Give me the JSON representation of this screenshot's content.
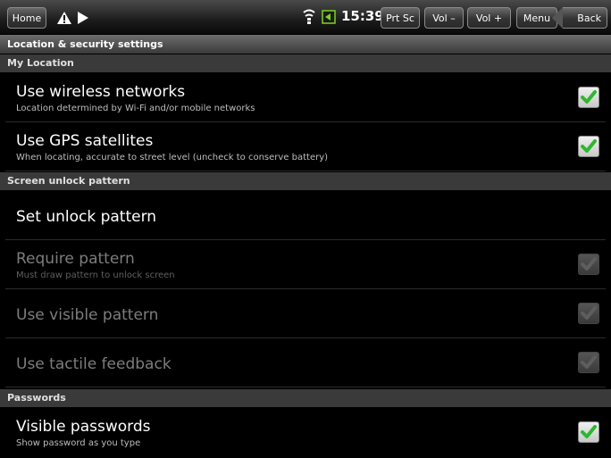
{
  "statusbar": {
    "home_label": "Home",
    "time": "15:39",
    "buttons": [
      "Prt Sc",
      "Vol –",
      "Vol +",
      "Menu"
    ],
    "back_label": "Back",
    "icons": [
      "warning-icon",
      "play-icon",
      "wifi-signal-icon",
      "battery-icon"
    ]
  },
  "page": {
    "title": "Location & security settings"
  },
  "sections": {
    "location": "My Location",
    "unlock": "Screen unlock pattern",
    "passwords": "Passwords"
  },
  "items": [
    {
      "title": "Use wireless networks",
      "summary": "Location determined by Wi-Fi and/or mobile networks",
      "checked": true,
      "enabled": true
    },
    {
      "title": "Use GPS satellites",
      "summary": "When locating, accurate to street level (uncheck to conserve battery)",
      "checked": true,
      "enabled": true
    },
    {
      "title": "Set unlock pattern",
      "summary": "",
      "enabled": true
    },
    {
      "title": "Require pattern",
      "summary": "Must draw pattern to unlock screen",
      "checked": true,
      "enabled": false
    },
    {
      "title": "Use visible pattern",
      "summary": "",
      "checked": true,
      "enabled": false
    },
    {
      "title": "Use tactile feedback",
      "summary": "",
      "checked": true,
      "enabled": false
    },
    {
      "title": "Visible passwords",
      "summary": "Show password as you type",
      "checked": true,
      "enabled": true
    }
  ],
  "colors": {
    "check_green": "#2eb82e",
    "section_bg": "#3a3a3a",
    "background": "#000000"
  }
}
